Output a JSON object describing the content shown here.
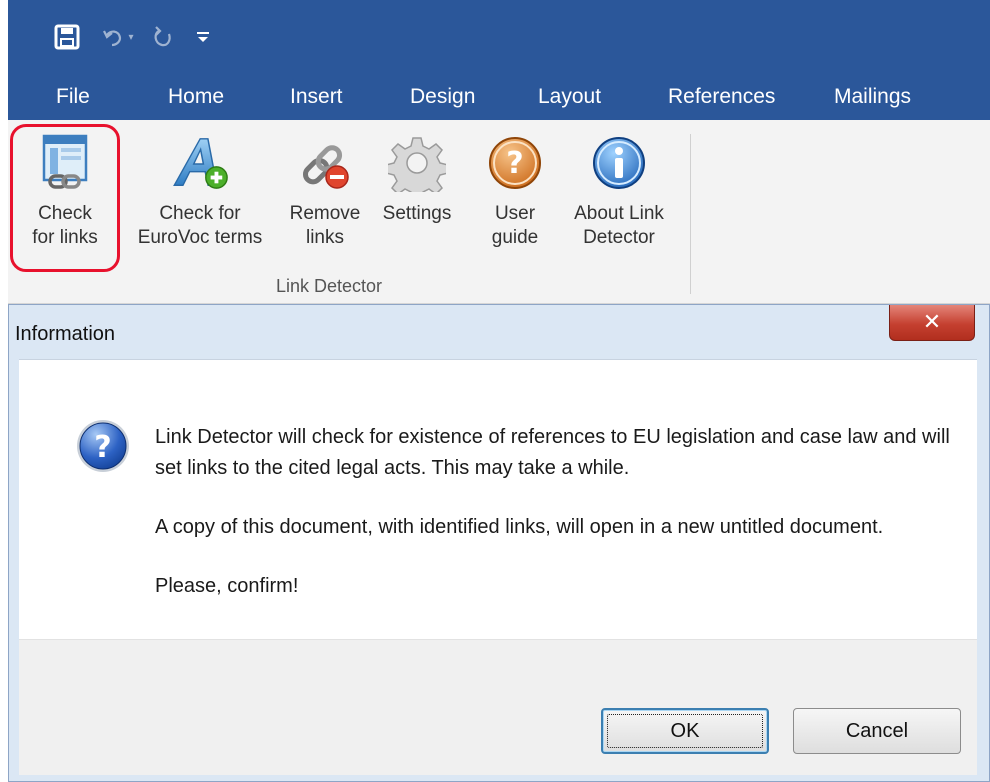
{
  "tabs": [
    "File",
    "Home",
    "Insert",
    "Design",
    "Layout",
    "References",
    "Mailings"
  ],
  "ribbon": {
    "buttons": [
      {
        "label": "Check\nfor links",
        "icon": "check-links-icon"
      },
      {
        "label": "Check for\nEuroVoc terms",
        "icon": "eurovoc-add-icon"
      },
      {
        "label": "Remove\nlinks",
        "icon": "remove-link-icon"
      },
      {
        "label": "Settings",
        "icon": "settings-gear-icon"
      },
      {
        "label": "User\nguide",
        "icon": "help-icon"
      },
      {
        "label": "About Link\nDetector",
        "icon": "info-icon"
      }
    ],
    "group_label": "Link Detector"
  },
  "dialog": {
    "title": "Information",
    "message": [
      "Link Detector will check for existence of references to EU legislation and case law and will set links to the cited legal acts. This may take a while.",
      "A copy of this document, with identified links, will open in a new untitled document.",
      "Please, confirm!"
    ],
    "ok_label": "OK",
    "cancel_label": "Cancel"
  },
  "colors": {
    "word_blue": "#2b579a",
    "highlight_red": "#e8112d",
    "close_red": "#c54030"
  }
}
